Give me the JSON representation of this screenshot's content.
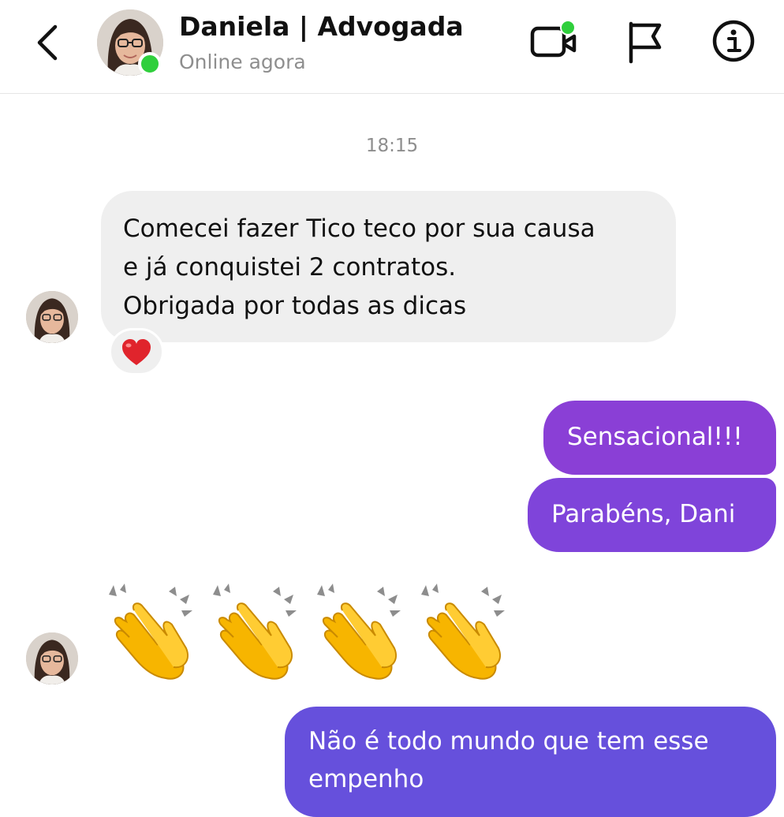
{
  "header": {
    "name": "Daniela | Advogada",
    "status": "Online agora",
    "back_icon": "chevron-left-icon",
    "video_icon": "video-call-icon",
    "flag_icon": "flag-icon",
    "info_icon": "info-icon",
    "online_color": "#2fcf3c"
  },
  "conversation": {
    "timestamp": "18:15",
    "messages": [
      {
        "from": "contact",
        "lines": [
          "Comecei fazer Tico teco por sua causa",
          "e já conquistei 2 contratos.",
          "Obrigada por todas as dicas"
        ],
        "reaction": "❤️"
      },
      {
        "from": "me",
        "text": "Sensacional!!!"
      },
      {
        "from": "me",
        "text": "Parabéns, Dani"
      },
      {
        "from": "contact",
        "emoji": [
          "👏",
          "👏",
          "👏",
          "👏"
        ]
      },
      {
        "from": "me",
        "lines": [
          "Não é todo mundo que tem esse",
          "empenho"
        ]
      }
    ]
  },
  "colors": {
    "incoming_bubble": "#efefef",
    "outgoing_gradient": [
      "#8a3fd6",
      "#7f44da",
      "#6650dc"
    ]
  }
}
